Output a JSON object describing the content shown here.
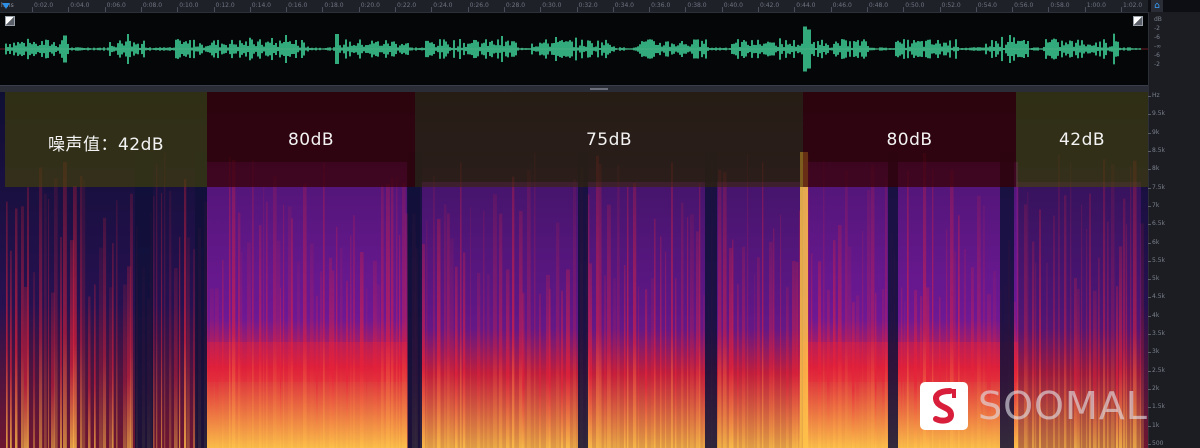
{
  "ruler": {
    "unit": "hms",
    "ticks": [
      "0:02.0",
      "0:04.0",
      "0:06.0",
      "0:08.0",
      "0:10.0",
      "0:12.0",
      "0:14.0",
      "0:16.0",
      "0:18.0",
      "0:20.0",
      "0:22.0",
      "0:24.0",
      "0:26.0",
      "0:28.0",
      "0:30.0",
      "0:32.0",
      "0:34.0",
      "0:36.0",
      "0:38.0",
      "0:40.0",
      "0:42.0",
      "0:44.0",
      "0:46.0",
      "0:48.0",
      "0:50.0",
      "0:52.0",
      "0:54.0",
      "0:56.0",
      "0:58.0",
      "1:00.0",
      "1:02.0"
    ]
  },
  "waveform": {
    "color": "#3fd39a",
    "db_scale": [
      "dB",
      "-2",
      "-6",
      "-∞",
      "-6",
      "-2"
    ]
  },
  "spectrogram": {
    "hz_scale": [
      "Hz",
      "9.5k",
      "9k",
      "8.5k",
      "8k",
      "7.5k",
      "7k",
      "6.5k",
      "6k",
      "5.5k",
      "5k",
      "4.5k",
      "4k",
      "3.5k",
      "3k",
      "2.5k",
      "2k",
      "1.5k",
      "1k",
      "500"
    ],
    "colors": {
      "low": "#10103a",
      "mid": "#7a1aa0",
      "high": "#e8223a",
      "peak": "#ffc34a"
    }
  },
  "noise_bands": [
    {
      "label": "噪声值：42dB",
      "color": "rgba(70,70,0,0.58)"
    },
    {
      "label": "80dB",
      "color": "rgba(55,0,0,0.72)"
    },
    {
      "label": "75dB",
      "color": "rgba(55,40,0,0.58)"
    },
    {
      "label": "80dB",
      "color": "rgba(55,0,0,0.72)"
    },
    {
      "label": "42dB",
      "color": "rgba(70,70,0,0.58)"
    }
  ],
  "watermark": {
    "text": "SOOMAL",
    "icon": "soomal-logo-icon"
  },
  "icons": {
    "playhead": "playhead-marker-icon",
    "home": "home-icon",
    "zoom_left": "zoom-corner-icon",
    "zoom_right": "zoom-corner-icon"
  }
}
